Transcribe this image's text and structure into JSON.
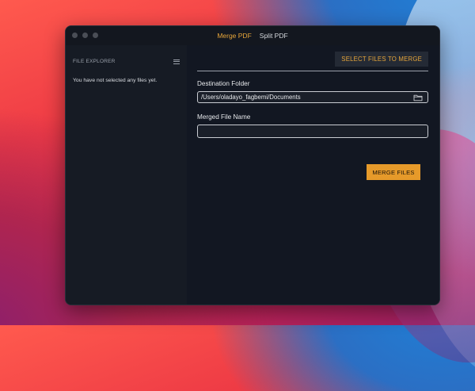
{
  "window": {
    "tabs": [
      {
        "label": "Merge PDF",
        "active": true
      },
      {
        "label": "Split PDF",
        "active": false
      }
    ]
  },
  "sidebar": {
    "title": "FILE EXPLORER",
    "menu_icon": "hamburger-menu-icon",
    "empty_message": "You have not selected any files yet."
  },
  "main": {
    "select_button_label": "SELECT FILES TO MERGE",
    "destination_label": "Destination Folder",
    "destination_value": "/Users/oladayo_fagbemi/Documents",
    "folder_icon": "folder-icon",
    "filename_label": "Merged File Name",
    "filename_value": "",
    "merge_button_label": "MERGE FILES"
  },
  "colors": {
    "accent": "#e6a53a",
    "merge_button_bg": "#e69a2a",
    "window_bg": "#121722",
    "sidebar_bg": "#161b24"
  }
}
